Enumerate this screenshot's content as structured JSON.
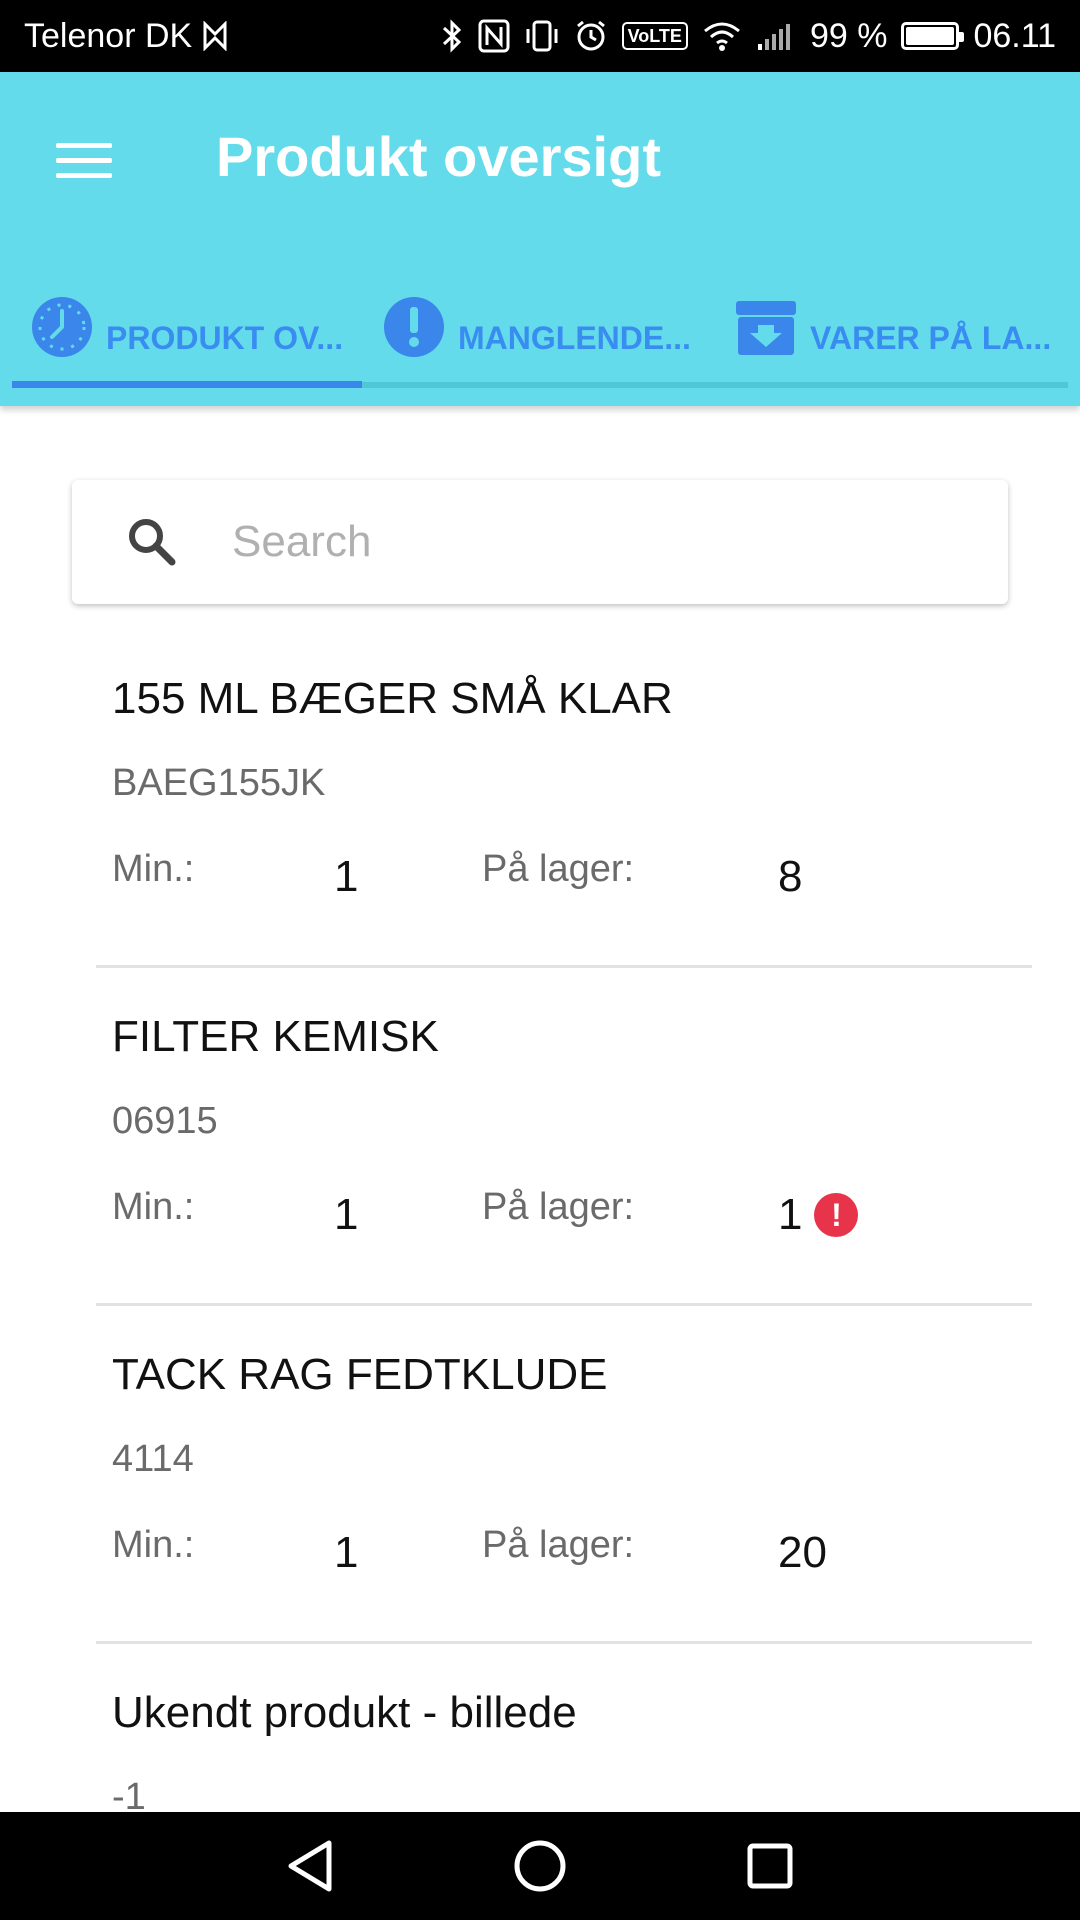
{
  "status_bar": {
    "carrier": "Telenor DK",
    "battery_percent": "99 %",
    "battery_level": 0.99,
    "time": "06.11",
    "volte": "VoLTE"
  },
  "app_bar": {
    "title": "Produkt oversigt",
    "tabs": [
      {
        "label": "PRODUKT OV...",
        "icon": "clock-icon",
        "active": true
      },
      {
        "label": "MANGLENDE...",
        "icon": "alert-icon",
        "active": false
      },
      {
        "label": "VARER PÅ LA...",
        "icon": "archive-download-icon",
        "active": false
      }
    ],
    "colors": {
      "background": "#64dbea",
      "tab_accent": "#3a86ea"
    }
  },
  "search": {
    "placeholder": "Search",
    "value": ""
  },
  "products": [
    {
      "name": "155 ML BÆGER SMÅ KLAR",
      "code": "BAEG155JK",
      "min_label": "Min.:",
      "min": "1",
      "stock_label": "På lager:",
      "stock": "8",
      "warning": false
    },
    {
      "name": "FILTER KEMISK",
      "code": "06915",
      "min_label": "Min.:",
      "min": "1",
      "stock_label": "På lager:",
      "stock": "1",
      "warning": true
    },
    {
      "name": "TACK RAG FEDTKLUDE",
      "code": "4114",
      "min_label": "Min.:",
      "min": "1",
      "stock_label": "På lager:",
      "stock": "20",
      "warning": false
    },
    {
      "name": "Ukendt produkt - billede",
      "code": "-1"
    }
  ],
  "warning_symbol": "!"
}
